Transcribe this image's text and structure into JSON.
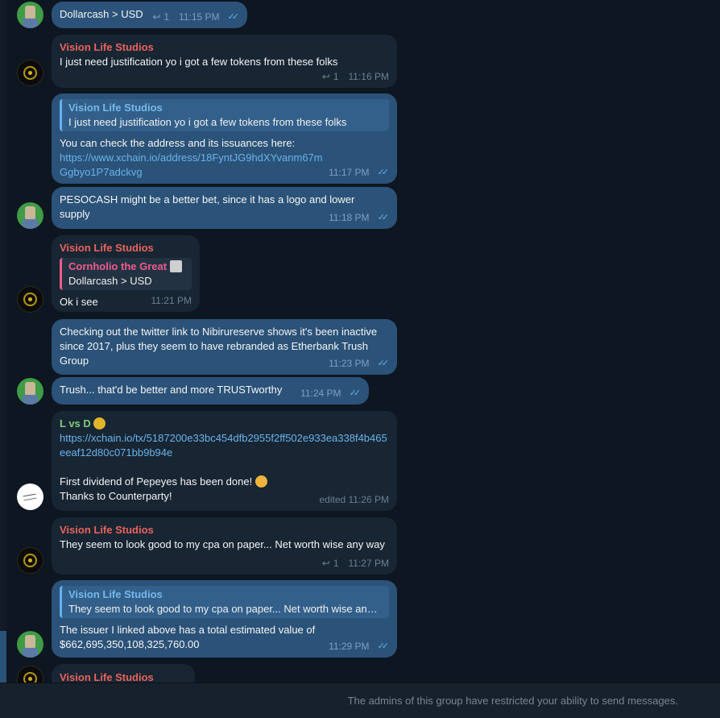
{
  "messages": [
    {
      "id": "m1",
      "text": "Dollarcash > USD",
      "reply_count": "1",
      "time": "11:15 PM"
    },
    {
      "id": "m2",
      "sender": "Vision Life Studios",
      "text": "I just need justification yo i got a few tokens from these folks",
      "reply_count": "1",
      "time": "11:16 PM"
    },
    {
      "id": "m3",
      "quote_sender": "Vision Life Studios",
      "quote_text": "I just need justification yo i got a few tokens from these folks",
      "text": "You can check the address and its issuances here:",
      "link": "https://www.xchain.io/address/18FyntJG9hdXYvanm67mGgbyo1P7adckvg",
      "time": "11:17 PM"
    },
    {
      "id": "m4",
      "text": "PESOCASH might be a better bet, since it has a logo and lower supply",
      "time": "11:18 PM"
    },
    {
      "id": "m5",
      "sender": "Vision Life Studios",
      "quote_sender": "Cornholio the Great",
      "quote_text": "Dollarcash > USD",
      "text": "Ok i see",
      "time": "11:21 PM"
    },
    {
      "id": "m6",
      "text": "Checking out the twitter link to Nibirureserve shows it's been inactive since 2017, plus they seem to have rebranded as Etherbank Trush Group",
      "time": "11:23 PM"
    },
    {
      "id": "m7",
      "text": "Trush... that'd be better and more TRUSTworthy",
      "time": "11:24 PM"
    },
    {
      "id": "m8",
      "sender": "L vs D",
      "link": "https://xchain.io/tx/5187200e33bc454dfb2955f2ff502e933ea338f4b465eeaf12d80c071bb9b94e",
      "text": "First dividend of Pepeyes has been done!",
      "text2": "Thanks to Counterparty!",
      "edited_time": "edited 11:26 PM"
    },
    {
      "id": "m9",
      "sender": "Vision Life Studios",
      "text": "They seem to look good to my cpa on paper... Net worth wise any way",
      "reply_count": "1",
      "time": "11:27 PM"
    },
    {
      "id": "m10",
      "quote_sender": "Vision Life Studios",
      "quote_text": "They seem to look good to my cpa on paper... Net worth wise any way",
      "text": "The issuer I linked above has a total estimated value of $662,695,350,108,325,760.00",
      "time": "11:29 PM"
    },
    {
      "id": "m11",
      "sender": "Vision Life Studios"
    }
  ],
  "footer": {
    "notice": "The admins of this group have restricted your ability to send messages."
  },
  "colors": {
    "background": "#0e1621",
    "incoming": "#182533",
    "outgoing": "#2b5278",
    "link": "#69b3ec",
    "sender_red": "#e9635d",
    "sender_green": "#7fcf7f",
    "sender_pink": "#ee5c8c"
  }
}
